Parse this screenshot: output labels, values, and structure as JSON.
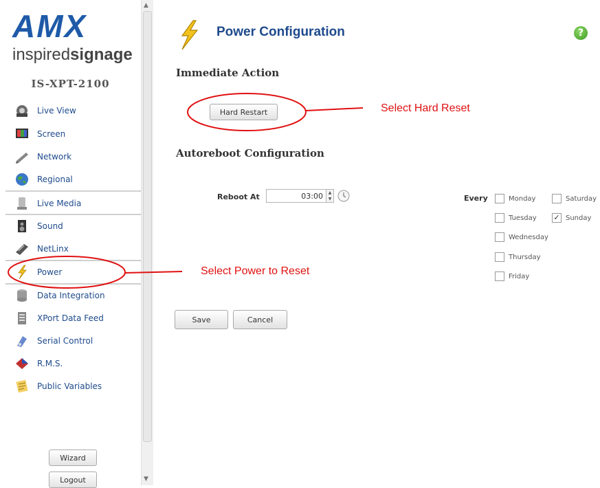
{
  "brand": {
    "logo_main": "AMX",
    "logo_sub_regular": "inspired",
    "logo_sub_bold": "signage",
    "device": "IS-XPT-2100"
  },
  "sidebar": {
    "items": [
      {
        "label": "Live View",
        "icon": "live-view-icon"
      },
      {
        "label": "Screen",
        "icon": "screen-icon"
      },
      {
        "label": "Network",
        "icon": "network-icon"
      },
      {
        "label": "Regional",
        "icon": "globe-icon"
      },
      {
        "label": "Live Media",
        "icon": "live-media-icon"
      },
      {
        "label": "Sound",
        "icon": "speaker-icon"
      },
      {
        "label": "NetLinx",
        "icon": "netlinx-icon"
      },
      {
        "label": "Power",
        "icon": "power-bolt-icon",
        "active": true
      },
      {
        "label": "Data Integration",
        "icon": "database-icon"
      },
      {
        "label": "XPort Data Feed",
        "icon": "data-feed-icon"
      },
      {
        "label": "Serial Control",
        "icon": "serial-icon"
      },
      {
        "label": "R.M.S.",
        "icon": "rms-icon"
      },
      {
        "label": "Public Variables",
        "icon": "notepad-icon"
      }
    ],
    "wizard_label": "Wizard",
    "logout_label": "Logout"
  },
  "main": {
    "title": "Power Configuration",
    "immediate_action": {
      "heading": "Immediate Action",
      "hard_restart_label": "Hard Restart"
    },
    "autoreboot": {
      "heading": "Autoreboot Configuration",
      "reboot_at_label": "Reboot At",
      "reboot_at_value": "03:00",
      "every_label": "Every",
      "days": [
        {
          "label": "Monday",
          "checked": false
        },
        {
          "label": "Tuesday",
          "checked": false
        },
        {
          "label": "Wednesday",
          "checked": false
        },
        {
          "label": "Thursday",
          "checked": false
        },
        {
          "label": "Friday",
          "checked": false
        },
        {
          "label": "Saturday",
          "checked": false
        },
        {
          "label": "Sunday",
          "checked": true
        }
      ]
    },
    "save_label": "Save",
    "cancel_label": "Cancel"
  },
  "annotations": {
    "hard_reset": "Select Hard Reset",
    "power_reset": "Select Power to Reset",
    "color": "#e01010"
  },
  "colors": {
    "nav_text": "#1e4a8c",
    "brand_blue": "#1e5aa8"
  }
}
